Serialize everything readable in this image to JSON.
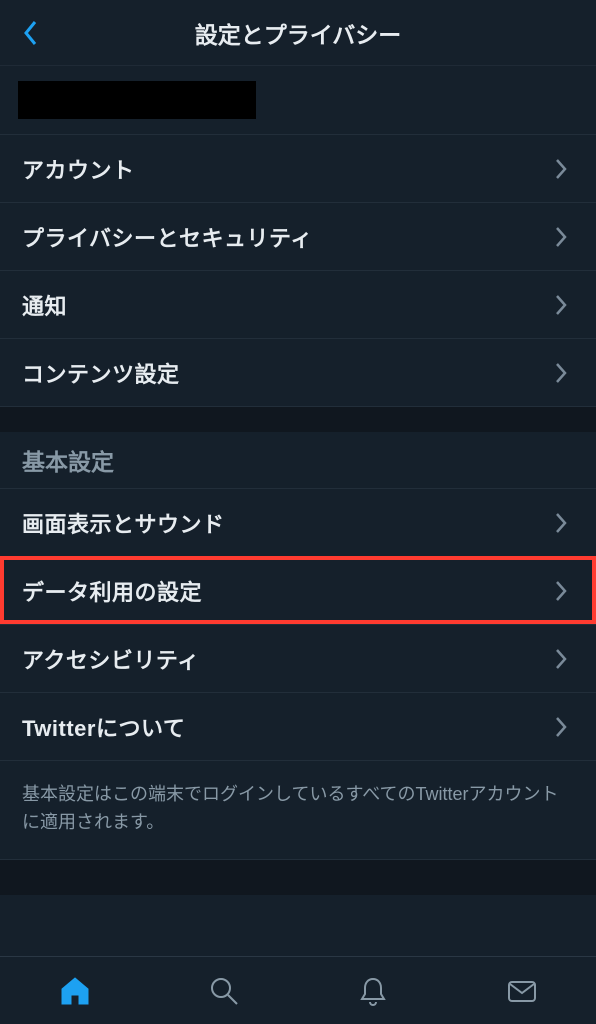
{
  "header": {
    "title": "設定とプライバシー"
  },
  "account_section": {
    "items": [
      {
        "label": "アカウント"
      },
      {
        "label": "プライバシーとセキュリティ"
      },
      {
        "label": "通知"
      },
      {
        "label": "コンテンツ設定"
      }
    ]
  },
  "general_section": {
    "header": "基本設定",
    "items": [
      {
        "label": "画面表示とサウンド"
      },
      {
        "label": "データ利用の設定"
      },
      {
        "label": "アクセシビリティ"
      },
      {
        "label": "Twitterについて"
      }
    ],
    "footer_note": "基本設定はこの端末でログインしているすべてのTwitterアカウントに適用されます。"
  },
  "tabbar": {
    "items": [
      {
        "name": "home"
      },
      {
        "name": "search"
      },
      {
        "name": "notifications"
      },
      {
        "name": "messages"
      }
    ]
  }
}
